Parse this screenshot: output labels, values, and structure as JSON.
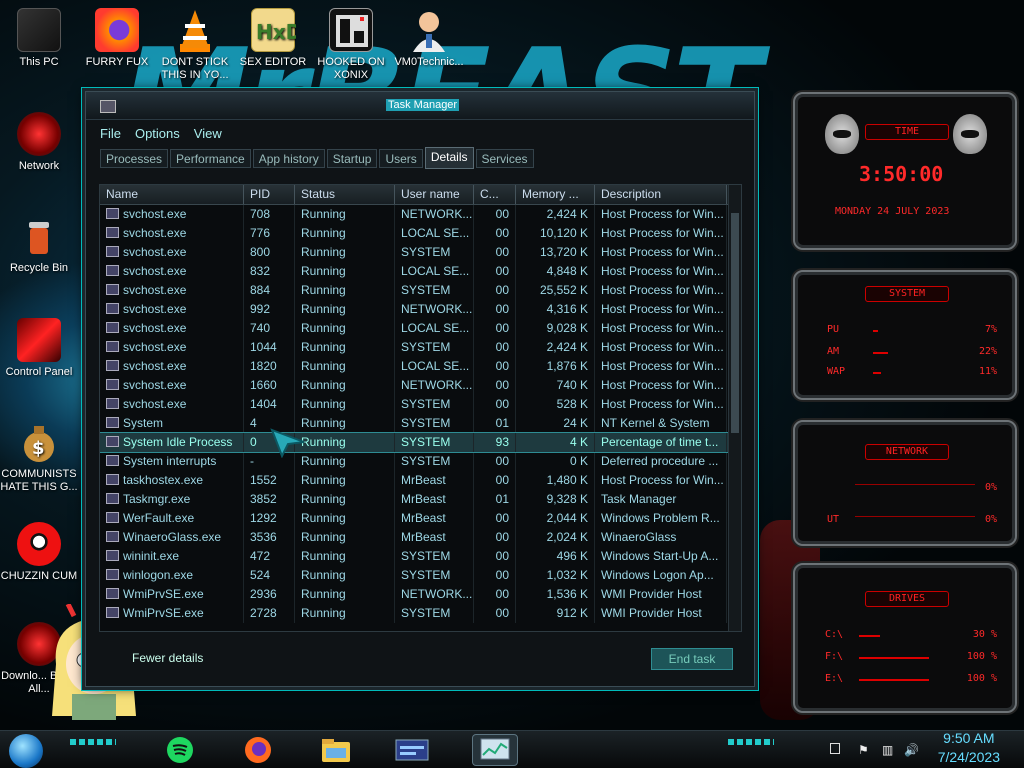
{
  "desktop": {
    "icons": [
      {
        "label": "This PC"
      },
      {
        "label": "FURRY FUX"
      },
      {
        "label": "DONT STICK THIS IN YO..."
      },
      {
        "label": "SEX EDITOR"
      },
      {
        "label": "HOOKED ON XONIX"
      },
      {
        "label": "VM0Technic..."
      },
      {
        "label": "Network"
      },
      {
        "label": "Recycle Bin"
      },
      {
        "label": "Control Panel"
      },
      {
        "label": "COMMUNISTS HATE THIS G..."
      },
      {
        "label": "CHUZZIN CUM"
      },
      {
        "label": "Downlo... Black All..."
      }
    ]
  },
  "task_manager": {
    "title": "Task Manager",
    "menu": [
      "File",
      "Options",
      "View"
    ],
    "tabs": [
      "Processes",
      "Performance",
      "App history",
      "Startup",
      "Users",
      "Details",
      "Services"
    ],
    "selected_tab": "Details",
    "columns": [
      "Name",
      "PID",
      "Status",
      "User name",
      "C...",
      "Memory ...",
      "Description"
    ],
    "rows": [
      {
        "name": "svchost.exe",
        "pid": "708",
        "status": "Running",
        "user": "NETWORK...",
        "cpu": "00",
        "mem": "2,424 K",
        "desc": "Host Process for Win..."
      },
      {
        "name": "svchost.exe",
        "pid": "776",
        "status": "Running",
        "user": "LOCAL SE...",
        "cpu": "00",
        "mem": "10,120 K",
        "desc": "Host Process for Win..."
      },
      {
        "name": "svchost.exe",
        "pid": "800",
        "status": "Running",
        "user": "SYSTEM",
        "cpu": "00",
        "mem": "13,720 K",
        "desc": "Host Process for Win..."
      },
      {
        "name": "svchost.exe",
        "pid": "832",
        "status": "Running",
        "user": "LOCAL SE...",
        "cpu": "00",
        "mem": "4,848 K",
        "desc": "Host Process for Win..."
      },
      {
        "name": "svchost.exe",
        "pid": "884",
        "status": "Running",
        "user": "SYSTEM",
        "cpu": "00",
        "mem": "25,552 K",
        "desc": "Host Process for Win..."
      },
      {
        "name": "svchost.exe",
        "pid": "992",
        "status": "Running",
        "user": "NETWORK...",
        "cpu": "00",
        "mem": "4,316 K",
        "desc": "Host Process for Win..."
      },
      {
        "name": "svchost.exe",
        "pid": "740",
        "status": "Running",
        "user": "LOCAL SE...",
        "cpu": "00",
        "mem": "9,028 K",
        "desc": "Host Process for Win..."
      },
      {
        "name": "svchost.exe",
        "pid": "1044",
        "status": "Running",
        "user": "SYSTEM",
        "cpu": "00",
        "mem": "2,424 K",
        "desc": "Host Process for Win..."
      },
      {
        "name": "svchost.exe",
        "pid": "1820",
        "status": "Running",
        "user": "LOCAL SE...",
        "cpu": "00",
        "mem": "1,876 K",
        "desc": "Host Process for Win..."
      },
      {
        "name": "svchost.exe",
        "pid": "1660",
        "status": "Running",
        "user": "NETWORK...",
        "cpu": "00",
        "mem": "740 K",
        "desc": "Host Process for Win..."
      },
      {
        "name": "svchost.exe",
        "pid": "1404",
        "status": "Running",
        "user": "SYSTEM",
        "cpu": "00",
        "mem": "528 K",
        "desc": "Host Process for Win..."
      },
      {
        "name": "System",
        "pid": "4",
        "status": "Running",
        "user": "SYSTEM",
        "cpu": "01",
        "mem": "24 K",
        "desc": "NT Kernel & System"
      },
      {
        "name": "System Idle Process",
        "pid": "0",
        "status": "Running",
        "user": "SYSTEM",
        "cpu": "93",
        "mem": "4 K",
        "desc": "Percentage of time t...",
        "selected": true
      },
      {
        "name": "System interrupts",
        "pid": "-",
        "status": "Running",
        "user": "SYSTEM",
        "cpu": "00",
        "mem": "0 K",
        "desc": "Deferred procedure ..."
      },
      {
        "name": "taskhostex.exe",
        "pid": "1552",
        "status": "Running",
        "user": "MrBeast",
        "cpu": "00",
        "mem": "1,480 K",
        "desc": "Host Process for Win..."
      },
      {
        "name": "Taskmgr.exe",
        "pid": "3852",
        "status": "Running",
        "user": "MrBeast",
        "cpu": "01",
        "mem": "9,328 K",
        "desc": "Task Manager"
      },
      {
        "name": "WerFault.exe",
        "pid": "1292",
        "status": "Running",
        "user": "MrBeast",
        "cpu": "00",
        "mem": "2,044 K",
        "desc": "Windows Problem R..."
      },
      {
        "name": "WinaeroGlass.exe",
        "pid": "3536",
        "status": "Running",
        "user": "MrBeast",
        "cpu": "00",
        "mem": "2,024 K",
        "desc": "WinaeroGlass"
      },
      {
        "name": "wininit.exe",
        "pid": "472",
        "status": "Running",
        "user": "SYSTEM",
        "cpu": "00",
        "mem": "496 K",
        "desc": "Windows Start-Up A..."
      },
      {
        "name": "winlogon.exe",
        "pid": "524",
        "status": "Running",
        "user": "SYSTEM",
        "cpu": "00",
        "mem": "1,032 K",
        "desc": "Windows Logon Ap..."
      },
      {
        "name": "WmiPrvSE.exe",
        "pid": "2936",
        "status": "Running",
        "user": "NETWORK...",
        "cpu": "00",
        "mem": "1,536 K",
        "desc": "WMI Provider Host"
      },
      {
        "name": "WmiPrvSE.exe",
        "pid": "2728",
        "status": "Running",
        "user": "SYSTEM",
        "cpu": "00",
        "mem": "912 K",
        "desc": "WMI Provider Host"
      }
    ],
    "fewer_details": "Fewer details",
    "end_task": "End task"
  },
  "gadgets": {
    "time": {
      "title": "TIME",
      "clock": "3:50:00",
      "date": "MONDAY 24 JULY 2023"
    },
    "system": {
      "title": "SYSTEM",
      "labels": [
        "PU",
        "AM",
        "WAP"
      ],
      "values": [
        "7%",
        "22%",
        "11%"
      ]
    },
    "network": {
      "title": "NETWORK",
      "values": [
        "0%",
        "0%"
      ],
      "labels": [
        "",
        "UT"
      ]
    },
    "drives": {
      "title": "DRIVES",
      "labels": [
        "C:\\",
        "F:\\",
        "E:\\"
      ],
      "values": [
        "30 %",
        "100 %",
        "100 %"
      ]
    }
  },
  "taskbar": {
    "time": "9:50 AM",
    "date": "7/24/2023"
  },
  "colors": {
    "accent": "#1fb6c9",
    "gadget_red": "#ff2a2a",
    "selected_row": "#1e3a3f"
  }
}
